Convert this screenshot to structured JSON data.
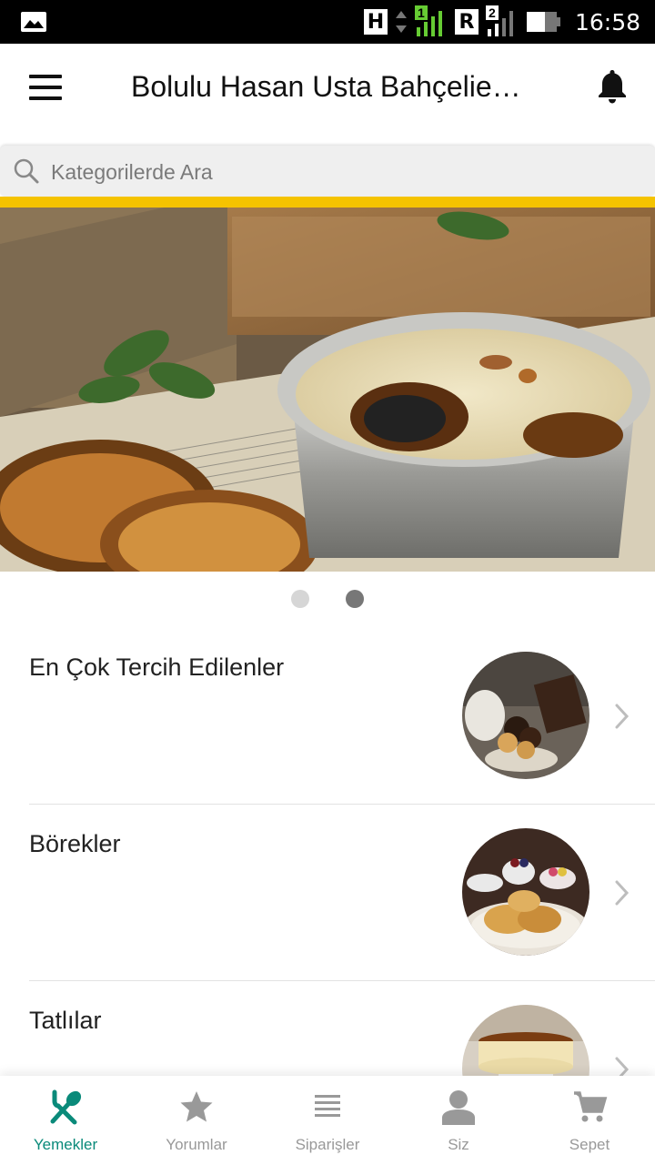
{
  "status_bar": {
    "network_h": "H",
    "sim1": "1",
    "network_r": "R",
    "sim2": "2",
    "time": "16:58"
  },
  "header": {
    "title": "Bolulu Hasan Usta Bahçelievler",
    "menu_icon": "hamburger-menu-icon",
    "bell_icon": "notification-bell-icon"
  },
  "search": {
    "placeholder": "Kategorilerde Ara"
  },
  "carousel": {
    "slide_count": 2,
    "active_index": 1
  },
  "categories": [
    {
      "label": "En Çok Tercih Edilenler"
    },
    {
      "label": "Börekler"
    },
    {
      "label": "Tatlılar"
    }
  ],
  "bottom_nav": {
    "active": "Yemekler",
    "items": [
      {
        "label": "Yemekler",
        "icon": "utensils-icon"
      },
      {
        "label": "Yorumlar",
        "icon": "star-icon"
      },
      {
        "label": "Siparişler",
        "icon": "list-icon"
      },
      {
        "label": "Siz",
        "icon": "person-icon"
      },
      {
        "label": "Sepet",
        "icon": "cart-icon"
      }
    ]
  },
  "colors": {
    "accent": "#0a8a7a",
    "yellow": "#f5c300",
    "inactive": "#999999"
  }
}
